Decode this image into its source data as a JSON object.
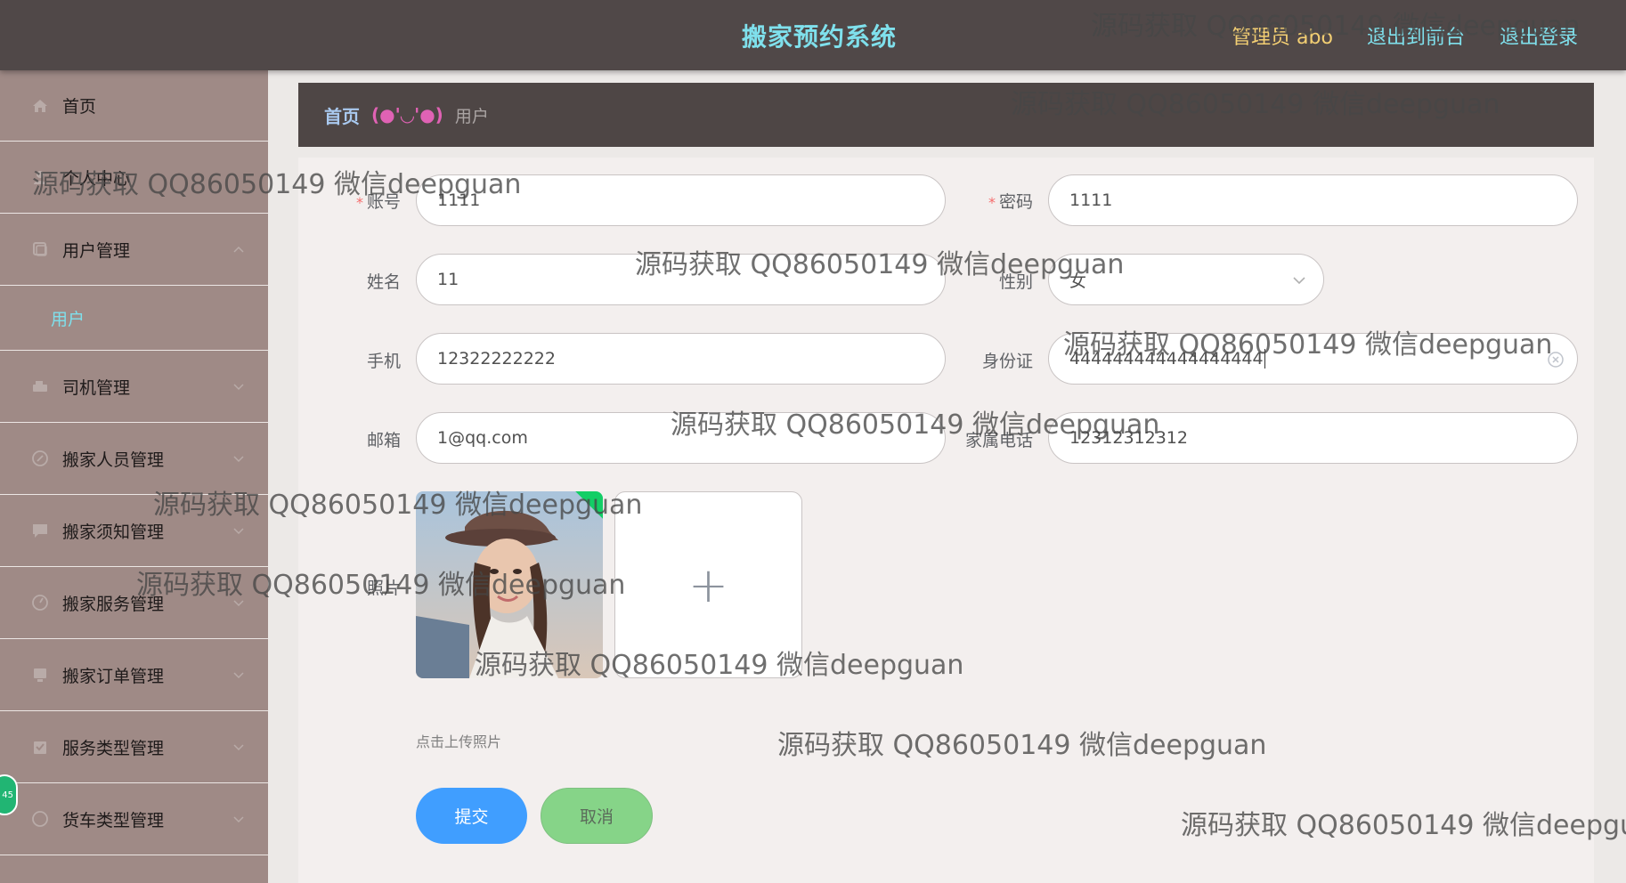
{
  "header": {
    "title": "搬家预约系统",
    "admin": "管理员 abo",
    "front_link": "退出到前台",
    "logout_link": "退出登录"
  },
  "sidebar": {
    "items": [
      {
        "label": "首页",
        "icon": "home-icon"
      },
      {
        "label": "个人中心",
        "icon": "user-icon"
      },
      {
        "label": "用户管理",
        "icon": "users-icon",
        "sub": [
          "用户"
        ]
      },
      {
        "label": "司机管理",
        "icon": "driver-icon"
      },
      {
        "label": "搬家人员管理",
        "icon": "staff-icon"
      },
      {
        "label": "搬家须知管理",
        "icon": "notice-icon"
      },
      {
        "label": "搬家服务管理",
        "icon": "service-icon"
      },
      {
        "label": "搬家订单管理",
        "icon": "order-icon"
      },
      {
        "label": "服务类型管理",
        "icon": "type-icon"
      },
      {
        "label": "货车类型管理",
        "icon": "truck-icon"
      }
    ],
    "badge": "45"
  },
  "breadcrumb": {
    "home": "首页",
    "separator": "(●'◡'●)",
    "current": "用户"
  },
  "form": {
    "account": {
      "label": "账号",
      "value": "1111",
      "required": true
    },
    "password": {
      "label": "密码",
      "value": "1111",
      "required": true
    },
    "name": {
      "label": "姓名",
      "value": "11"
    },
    "gender": {
      "label": "性别",
      "value": "女"
    },
    "phone": {
      "label": "手机",
      "value": "12322222222"
    },
    "id_card": {
      "label": "身份证",
      "value": "444444444444444444"
    },
    "email": {
      "label": "邮箱",
      "value": "1@qq.com"
    },
    "family_phone": {
      "label": "家属电话",
      "value": "12312312312"
    },
    "photo": {
      "label": "照片",
      "tip": "点击上传照片"
    },
    "submit": "提交",
    "cancel": "取消"
  },
  "watermark": "源码获取 QQ86050149 微信deepguan",
  "colors": {
    "header_bg": "#504848",
    "sidebar_bg": "#9f8a86",
    "accent_cyan": "#7fe0ec",
    "admin_yellow": "#f3cf73",
    "submit_blue": "#409eff",
    "cancel_green": "#86d488"
  }
}
